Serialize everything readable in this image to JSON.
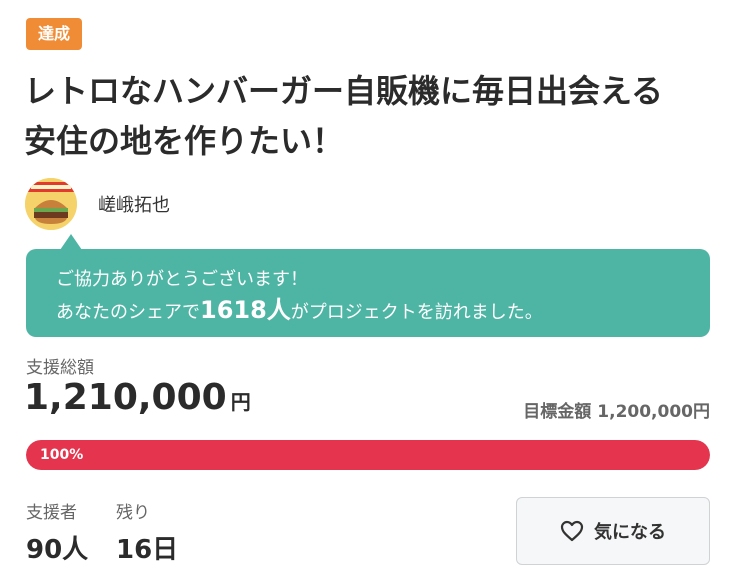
{
  "status_badge": "達成",
  "project": {
    "title_line1": "レトロなハンバーガー自販機に毎日出会える",
    "title_line2": "安住の地を作りたい！"
  },
  "owner": {
    "name": "嵯峨拓也",
    "avatar_icon": "hamburger-avatar"
  },
  "thanks": {
    "line1": "ご協力ありがとうございます！",
    "line2_prefix": "あなたのシェアで",
    "count": "1618人",
    "line2_suffix": "がプロジェクトを訪れました。",
    "bg_color": "#4eb5a5"
  },
  "funding": {
    "total_label": "支援総額",
    "total_amount": "1,210,000",
    "currency": "円",
    "goal_label": "目標金額",
    "goal_amount": "1,200,000円",
    "progress_text": "100%",
    "progress_value": 1.0,
    "progress_color": "#e5344e"
  },
  "stats": {
    "supporters_label": "支援者",
    "supporters_value": "90人",
    "remaining_label": "残り",
    "remaining_value": "16日"
  },
  "favorite": {
    "label": "気になる",
    "icon": "heart-icon"
  }
}
